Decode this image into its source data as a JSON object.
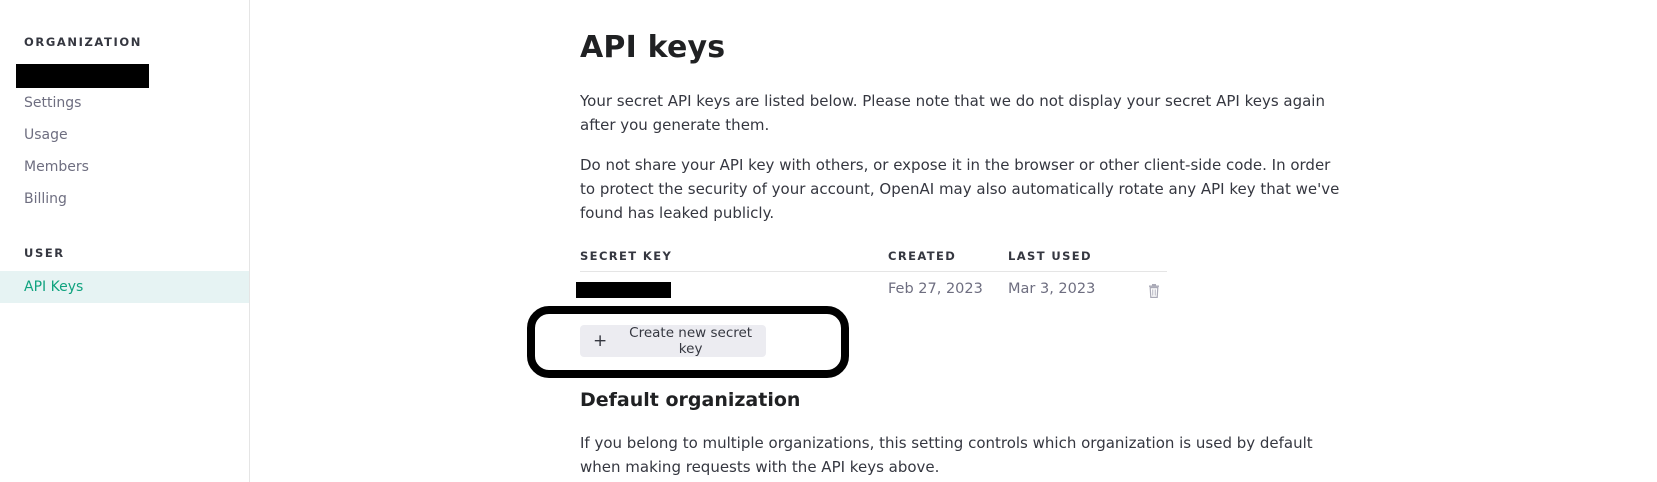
{
  "sidebar": {
    "organization_label": "ORGANIZATION",
    "org_items": [
      {
        "label": "Settings"
      },
      {
        "label": "Usage"
      },
      {
        "label": "Members"
      },
      {
        "label": "Billing"
      }
    ],
    "user_label": "USER",
    "user_items": [
      {
        "label": "API Keys",
        "active": true
      }
    ]
  },
  "main": {
    "title": "API keys",
    "intro_paragraphs": [
      "Your secret API keys are listed below. Please note that we do not display your secret API keys again after you generate them.",
      "Do not share your API key with others, or expose it in the browser or other client-side code. In order to protect the security of your account, OpenAI may also automatically rotate any API key that we've found has leaked publicly."
    ],
    "table": {
      "headers": [
        "SECRET KEY",
        "CREATED",
        "LAST USED"
      ],
      "rows": [
        {
          "created": "Feb 27, 2023",
          "last_used": "Mar 3, 2023",
          "action_icon": "trash-icon"
        }
      ]
    },
    "create_button_label": "Create new secret key",
    "create_button_icon": "plus-icon",
    "default_org_heading": "Default organization",
    "default_org_text": "If you belong to multiple organizations, this setting controls which organization is used by default when making requests with the API keys above."
  },
  "colors": {
    "accent": "#10a37f",
    "active_bg": "#e6f3f3",
    "button_bg": "#ececf1"
  }
}
